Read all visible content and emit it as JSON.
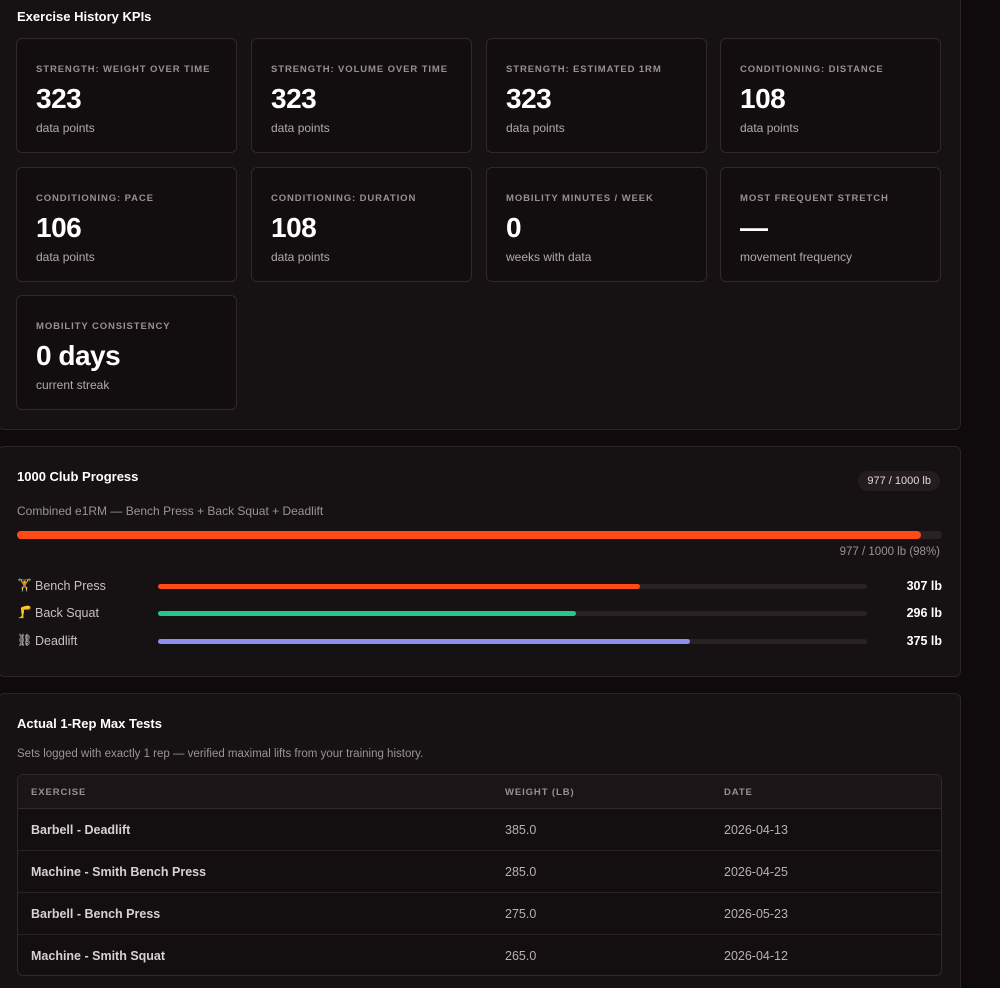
{
  "kpis": {
    "title": "Exercise History KPIs",
    "cards": [
      {
        "label": "STRENGTH: WEIGHT OVER TIME",
        "value": "323",
        "sub": "data points"
      },
      {
        "label": "STRENGTH: VOLUME OVER TIME",
        "value": "323",
        "sub": "data points"
      },
      {
        "label": "STRENGTH: ESTIMATED 1RM",
        "value": "323",
        "sub": "data points"
      },
      {
        "label": "CONDITIONING: DISTANCE",
        "value": "108",
        "sub": "data points"
      },
      {
        "label": "CONDITIONING: PACE",
        "value": "106",
        "sub": "data points"
      },
      {
        "label": "CONDITIONING: DURATION",
        "value": "108",
        "sub": "data points"
      },
      {
        "label": "MOBILITY MINUTES / WEEK",
        "value": "0",
        "sub": "weeks with data"
      },
      {
        "label": "MOST FREQUENT STRETCH",
        "value": "—",
        "sub": "movement frequency"
      },
      {
        "label": "MOBILITY CONSISTENCY",
        "value": "0 days",
        "sub": "current streak"
      }
    ]
  },
  "club": {
    "title": "1000 Club Progress",
    "badge": "977 / 1000 lb",
    "description": "Combined e1RM — Bench Press + Back Squat + Deadlift",
    "progress_fraction": 0.977,
    "progress_caption": "977 / 1000 lb (98%)",
    "lifts": [
      {
        "icon": "🏋",
        "icon_name": "barbell-icon",
        "name": "Bench Press",
        "value": "307 lb",
        "fraction": 0.68,
        "color": "#ff4a16"
      },
      {
        "icon": "🦵",
        "icon_name": "leg-icon",
        "name": "Back Squat",
        "value": "296 lb",
        "fraction": 0.59,
        "color": "#22c98a"
      },
      {
        "icon": "⛓",
        "icon_name": "chain-icon",
        "name": "Deadlift",
        "value": "375 lb",
        "fraction": 0.75,
        "color": "#8d8ff0"
      }
    ]
  },
  "tests": {
    "title": "Actual 1-Rep Max Tests",
    "description": "Sets logged with exactly 1 rep — verified maximal lifts from your training history.",
    "columns": [
      "EXERCISE",
      "WEIGHT (LB)",
      "DATE"
    ],
    "rows": [
      {
        "exercise": "Barbell - Deadlift",
        "weight": "385.0",
        "date": "2026-04-13"
      },
      {
        "exercise": "Machine - Smith Bench Press",
        "weight": "285.0",
        "date": "2026-04-25"
      },
      {
        "exercise": "Barbell - Bench Press",
        "weight": "275.0",
        "date": "2026-05-23"
      },
      {
        "exercise": "Machine - Smith Squat",
        "weight": "265.0",
        "date": "2026-04-12"
      }
    ]
  }
}
